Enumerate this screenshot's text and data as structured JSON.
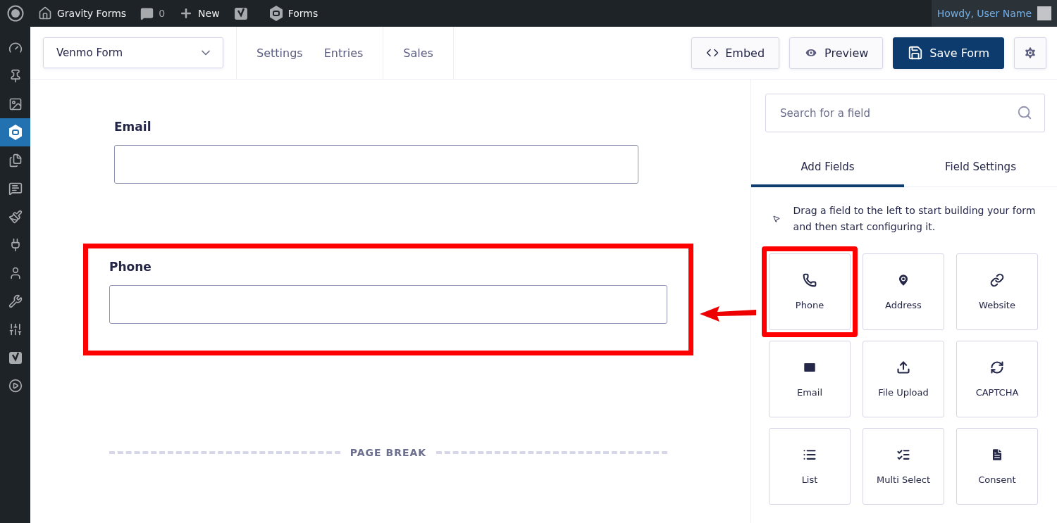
{
  "admin_bar": {
    "site": "Gravity Forms",
    "comments": "0",
    "new": "New",
    "forms": "Forms",
    "greeting": "Howdy, User Name"
  },
  "sidebar": {
    "items": [
      {
        "selected": false
      },
      {
        "selected": false
      },
      {
        "selected": false
      },
      {
        "selected": true
      },
      {
        "selected": false
      },
      {
        "selected": false
      },
      {
        "selected": false
      },
      {
        "selected": false
      },
      {
        "selected": false
      },
      {
        "selected": false
      },
      {
        "selected": false
      },
      {
        "selected": false
      },
      {
        "selected": false
      }
    ]
  },
  "toolbar": {
    "form_select": "Venmo Form",
    "nav": [
      "Settings",
      "Entries",
      "Sales"
    ],
    "embed": "Embed",
    "preview": "Preview",
    "save": "Save Form"
  },
  "canvas": {
    "fields": [
      {
        "label": "Email",
        "highlighted": false
      },
      {
        "label": "Phone",
        "highlighted": true
      }
    ],
    "page_break": "PAGE BREAK"
  },
  "panel": {
    "search": {
      "placeholder": "Search for a field"
    },
    "tabs": [
      {
        "label": "Add Fields",
        "selected": true
      },
      {
        "label": "Field Settings",
        "selected": false
      }
    ],
    "hint": "Drag a field to the left to start building your form and then start configuring it.",
    "tiles": [
      {
        "label": "Phone",
        "highlighted": true
      },
      {
        "label": "Address",
        "highlighted": false
      },
      {
        "label": "Website",
        "highlighted": false
      },
      {
        "label": "Email",
        "highlighted": false
      },
      {
        "label": "File Upload",
        "highlighted": false
      },
      {
        "label": "CAPTCHA",
        "highlighted": false
      },
      {
        "label": "List",
        "highlighted": false
      },
      {
        "label": "Multi Select",
        "highlighted": false
      },
      {
        "label": "Consent",
        "highlighted": false
      }
    ]
  }
}
